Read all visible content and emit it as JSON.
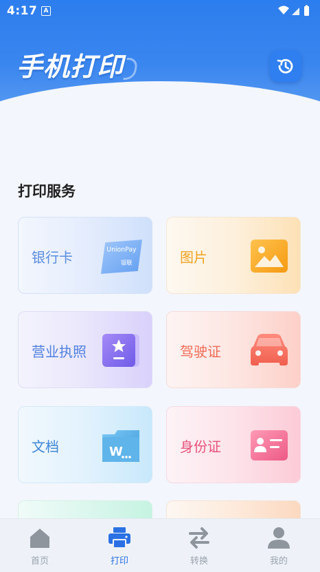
{
  "status": {
    "time": "4:17",
    "a_badge": "A"
  },
  "header": {
    "title": "手机打印"
  },
  "section": {
    "title": "打印服务"
  },
  "cards": [
    {
      "label": "银行卡",
      "color": "#5b8de0",
      "icon": "bank-card-icon",
      "sub1": "UnionPay",
      "sub2": "银联"
    },
    {
      "label": "图片",
      "color": "#f1a21f",
      "icon": "image-icon"
    },
    {
      "label": "营业执照",
      "color": "#4f7fe0",
      "icon": "business-license-icon"
    },
    {
      "label": "驾驶证",
      "color": "#f06a54",
      "icon": "car-icon"
    },
    {
      "label": "文档",
      "color": "#3f86d8",
      "icon": "word-document-icon",
      "sub1": "W"
    },
    {
      "label": "身份证",
      "color": "#e8517a",
      "icon": "id-card-icon"
    }
  ],
  "tabs": [
    {
      "label": "首页",
      "icon": "home-icon"
    },
    {
      "label": "打印",
      "icon": "printer-icon"
    },
    {
      "label": "转换",
      "icon": "convert-icon"
    },
    {
      "label": "我的",
      "icon": "user-icon"
    }
  ],
  "active_tab": "打印",
  "colors": {
    "primary": "#2c7dee",
    "active_tab": "#2b71e4",
    "inactive_tab": "#9aa3ad"
  }
}
